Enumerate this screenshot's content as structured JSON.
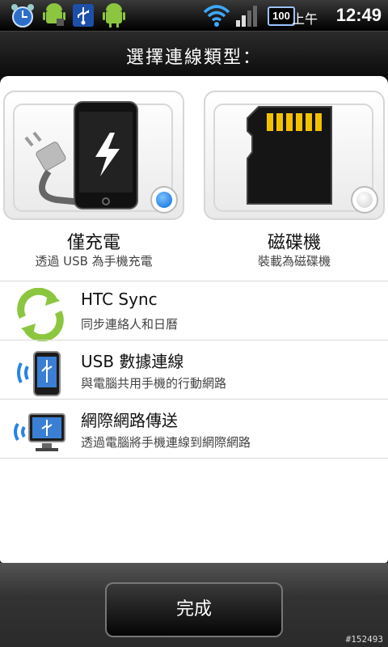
{
  "status_bar": {
    "battery": "100",
    "ampm": "上午",
    "time": "12:49"
  },
  "dialog": {
    "title": "選擇連線類型："
  },
  "options_top": [
    {
      "title": "僅充電",
      "subtitle": "透過 USB 為手機充電",
      "selected": true
    },
    {
      "title": "磁碟機",
      "subtitle": "裝載為磁碟機",
      "selected": false
    }
  ],
  "options_list": [
    {
      "title": "HTC Sync",
      "subtitle": "同步連絡人和日曆"
    },
    {
      "title": "USB 數據連線",
      "subtitle": "與電腦共用手機的行動網路"
    },
    {
      "title": "網際網路傳送",
      "subtitle": "透過電腦將手機連線到網際網路"
    }
  ],
  "footer": {
    "done_label": "完成",
    "watermark": "#152493"
  },
  "colors": {
    "accent": "#2a83e6",
    "sync_green": "#8cc63f"
  }
}
